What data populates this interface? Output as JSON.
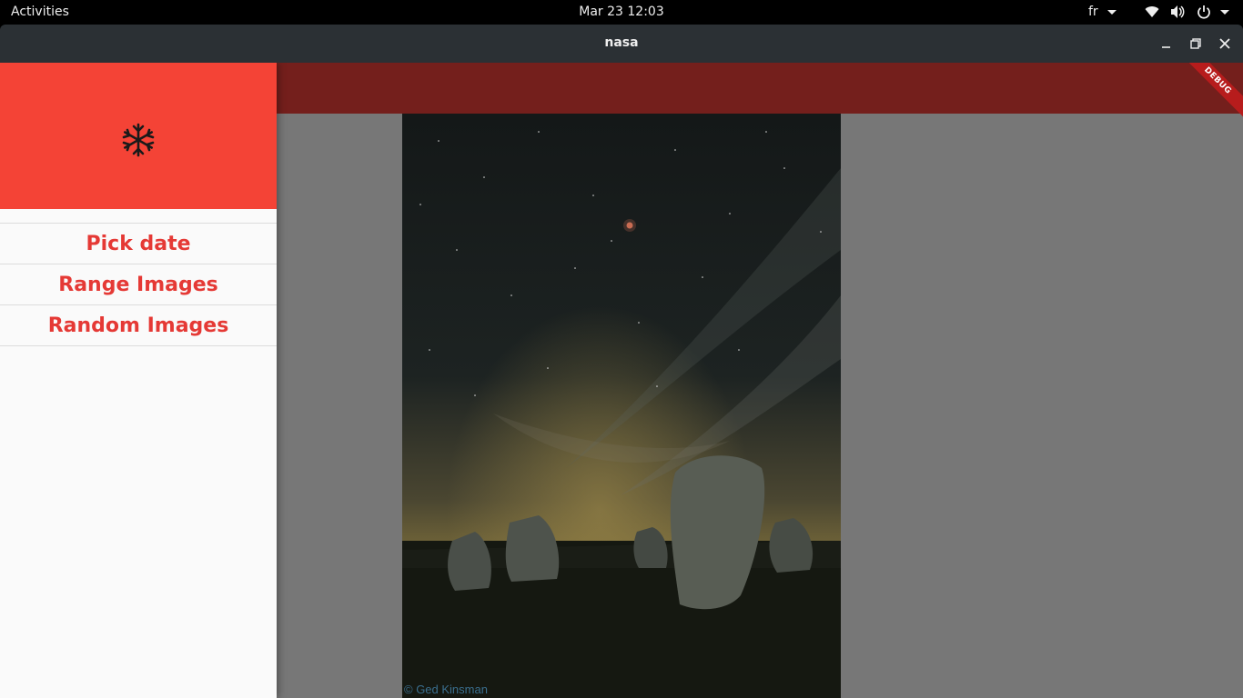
{
  "topbar": {
    "activities": "Activities",
    "clock": "Mar 23  12:03",
    "language": "fr",
    "icons": [
      "wifi-icon",
      "volume-icon",
      "power-icon"
    ]
  },
  "window": {
    "title": "nasa",
    "controls": [
      "minimize-icon",
      "maximize-icon",
      "close-icon"
    ]
  },
  "app": {
    "colors": {
      "appbar": "#741f1c",
      "drawer_header": "#f44336",
      "menu_text": "#e53935",
      "background": "#777777"
    },
    "debug_banner": "DEBUG",
    "drawer": {
      "header_icon": "snowflake-icon",
      "items": [
        {
          "label": "Pick date"
        },
        {
          "label": "Range Images"
        },
        {
          "label": "Random Images"
        }
      ]
    },
    "image": {
      "credit": "© Ged Kinsman"
    }
  }
}
